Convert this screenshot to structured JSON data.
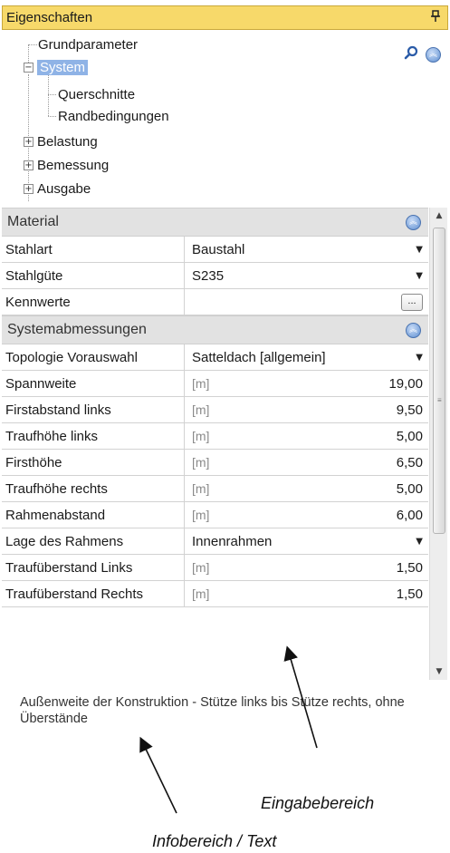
{
  "panel": {
    "title": "Eigenschaften",
    "pin": "p"
  },
  "tree": {
    "items": [
      {
        "label": "Grundparameter"
      },
      {
        "label": "System",
        "expander": "−"
      },
      {
        "label": "Querschnitte"
      },
      {
        "label": "Randbedingungen"
      },
      {
        "label": "Belastung",
        "expander": "+"
      },
      {
        "label": "Bemessung",
        "expander": "+"
      },
      {
        "label": "Ausgabe",
        "expander": "+"
      }
    ]
  },
  "sections": {
    "material": {
      "title": "Material",
      "rows": [
        {
          "name": "Stahlart",
          "value": "Baustahl"
        },
        {
          "name": "Stahlgüte",
          "value": "S235"
        },
        {
          "name": "Kennwerte",
          "button": "..."
        }
      ]
    },
    "system": {
      "title": "Systemabmessungen",
      "rows": [
        {
          "name": "Topologie Vorauswahl",
          "value": "Satteldach [allgemein]"
        },
        {
          "name": "Spannweite",
          "unit": "[m]",
          "value": "19,00"
        },
        {
          "name": "Firstabstand links",
          "unit": "[m]",
          "value": "9,50"
        },
        {
          "name": "Traufhöhe links",
          "unit": "[m]",
          "value": "5,00"
        },
        {
          "name": "Firsthöhe",
          "unit": "[m]",
          "value": "6,50"
        },
        {
          "name": "Traufhöhe rechts",
          "unit": "[m]",
          "value": "5,00"
        },
        {
          "name": "Rahmenabstand",
          "unit": "[m]",
          "value": "6,00"
        },
        {
          "name": "Lage des Rahmens",
          "value": "Innenrahmen"
        },
        {
          "name": "Traufüberstand Links",
          "unit": "[m]",
          "value": "1,50"
        },
        {
          "name": "Traufüberstand Rechts",
          "unit": "[m]",
          "value": "1,50"
        }
      ]
    }
  },
  "info": {
    "text": "Außenweite der Konstruktion - Stütze links bis Stütze rechts, ohne Überstände"
  },
  "annotations": {
    "input_area": "Eingabebereich",
    "info_area": "Infobereich / Text"
  },
  "colors": {
    "title_bar": "#f7d96a",
    "selection": "#8fb3e6",
    "section_header": "#e2e2e2"
  }
}
